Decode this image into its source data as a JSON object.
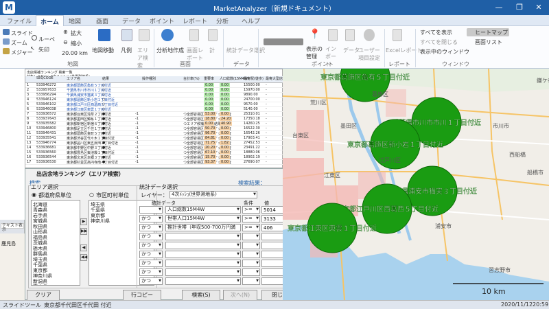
{
  "window": {
    "title": "MarketAnalyzer（新規ドキュメント）"
  },
  "menu": [
    "ファイル",
    "ホーム",
    "地図",
    "画面",
    "データ",
    "ポイント",
    "レポート",
    "分析",
    "ヘルプ"
  ],
  "ribbon": {
    "slide": "スライド",
    "zoom": "ズーム",
    "measure": "メジャー",
    "loupe": "ルーペ",
    "arrow": "矢印",
    "zoom_in": "拡大",
    "zoom_out": "縮小",
    "scale": "20.00 km",
    "map_move": "地図移動",
    "legend": "凡例",
    "area_search": "エリア検索",
    "map_create": "分析地作成",
    "screen_report": "画面レポート",
    "total": "計",
    "stats_select": "統計データ選択",
    "point_show": "表示の管理",
    "import": "インポート",
    "data": "データ",
    "user_settings": "ユーザー項目設定",
    "excel_report": "Excelレポート",
    "show_all": "すべてを表示",
    "hide_all": "すべてを閉じる",
    "window_show": "表示中のウィンドウ",
    "heatmap": "ヒートマップ",
    "screen_list": "画面リスト",
    "group_map": "地図",
    "group_screen": "画面",
    "group_data": "データ",
    "group_point": "ポイント",
    "group_report": "レポート",
    "group_window": "ウィンドウ"
  },
  "leftstrip": {
    "items": [
      "福岡県",
      "福岡市",
      "鹿児島",
      "テキスト表示",
      "福岡県"
    ]
  },
  "grid": {
    "title": "出店候補ランキング 検索一覧",
    "layer": "対象レイヤー：4次メッシュ(世界測地系)",
    "headers": [
      "SEQCODE",
      "エリア名",
      "結果",
      "操作種別",
      "台計率(%)",
      "重要率",
      "人口総数(15M4W)",
      "最寄駅(徒歩)",
      "最寄大型店"
    ],
    "rows": [
      [
        "533946272",
        "東京都葛飾区亀有５丁目付近",
        "○",
        "",
        "",
        "0.00",
        "0.00",
        "15500.00",
        "-"
      ],
      [
        "533957633",
        "千葉県市川市市川１丁目付近",
        "○",
        "",
        "",
        "0.00",
        "0.00",
        "15970.00",
        "-"
      ],
      [
        "533956294",
        "千葉県浦安市猫実３丁目付近",
        "○",
        "",
        "",
        "0.00",
        "0.00",
        "9890.00",
        "-"
      ],
      [
        "533946124",
        "東京都葛飾区新小岩１丁目付近",
        "○",
        "",
        "",
        "0.00",
        "0.00",
        "24700.00",
        "-"
      ],
      [
        "533946102",
        "東京都江戸川区西葛西５丁目付近",
        "○",
        "",
        "",
        "0.00",
        "0.00",
        "9570.00",
        "-"
      ],
      [
        "533946038",
        "東京都江東区東雲１丁目付近",
        "○",
        "",
        "",
        "0.00",
        "0.00",
        "5140.00",
        "-"
      ],
      [
        "533936572",
        "東京都台東区浅草２丁目付近",
        "●",
        "-1",
        "つ全部容易区のマーケット調査",
        "53.00",
        "0.00",
        "25310.01",
        "-"
      ],
      [
        "533937643",
        "東京都墨田区錦糸１丁目付近",
        "●",
        "-1",
        "つ全部容易区のマーケット調査",
        "18.80",
        "24.20",
        "17350.18",
        "-"
      ],
      [
        "533935582",
        "東京都新宿区新宿６丁目付近",
        "●",
        "-1",
        "つエリア候補の調査結果",
        "0.00",
        "40.90",
        "14260.25",
        "-"
      ],
      [
        "533946800",
        "東京都足立区千住１丁目付近",
        "●",
        "-1",
        "つ全部容易区のマーケット調査",
        "50.70",
        "0.00",
        "16522.30",
        "-"
      ],
      [
        "533946431",
        "東京都葛飾区金町５丁目付近",
        "●",
        "-1",
        "つ全部容易区のマーケット調査",
        "96.70",
        "0.00",
        "16542.26",
        "-"
      ],
      [
        "533935541",
        "東京都渋谷区代々木１丁目付近",
        "●",
        "-1",
        "つ全部容易区のマーケット調査",
        "84.81",
        "0.00",
        "17903.41",
        "-"
      ],
      [
        "533946774",
        "東京都品川区東五反田２丁目付近",
        "●",
        "-1",
        "つ全部容易区のマーケット調査",
        "71.75",
        "1.82",
        "27452.53",
        "-"
      ],
      [
        "533936681",
        "東京都中野区中野３丁目付近",
        "●",
        "-1",
        "つ全部容易区のマーケット調査",
        "20.20",
        "0.00",
        "23491.22",
        "-"
      ],
      [
        "533936560",
        "東京都豊島区東池袋１丁目付近",
        "●",
        "-1",
        "つ全部容易区のマーケット調査",
        "67.10",
        "0.00",
        "18880.06",
        "-"
      ],
      [
        "533936544",
        "東京都文京区本郷３丁目付近",
        "●",
        "-1",
        "つ全部容易区のマーケット調査",
        "15.70",
        "0.00",
        "18902.19",
        "-"
      ],
      [
        "533936530",
        "東京都杉並区高円寺南４丁目付近",
        "●",
        "-1",
        "つ全部容易区のマーケット調査",
        "93.37",
        "0.00",
        "27690.07",
        "-"
      ]
    ]
  },
  "dialog": {
    "title": "出店余地ランキング（エリア検索）",
    "search_label": "検索",
    "result_label": "検索結果：",
    "result_value": "0",
    "area_select": "エリア選択",
    "radio_pref": "都道府県単位",
    "radio_city": "市区町村単位",
    "prefectures": [
      "北海道",
      "青森県",
      "岩手県",
      "宮城県",
      "秋田県",
      "山形県",
      "福島県",
      "茨城県",
      "栃木県",
      "群馬県",
      "埼玉県",
      "千葉県",
      "東京都",
      "神奈川県",
      "新潟県",
      "富山県",
      "石川県",
      "福井県",
      "山梨県",
      "長野県"
    ],
    "selected": [
      "埼玉県",
      "千葉県",
      "東京都",
      "神奈川県"
    ],
    "stats_select": "統計データ選択",
    "layer_label": "レイヤー：",
    "layer_value": "4次ﾒｯｼｭ(世界測地系)",
    "stats_data": "統計データ",
    "cond_label": "条件",
    "value_label": "値",
    "conditions": [
      {
        "op": "",
        "field": "人口総数15M4W",
        "cmp": ">=",
        "value": "5014"
      },
      {
        "op": "かつ",
        "field": "世帯人口15M4W",
        "cmp": ">=",
        "value": "3133"
      },
      {
        "op": "かつ",
        "field": "推計世帯（年収500-700万円満_8階級）13",
        "cmp": ">=",
        "value": "406"
      },
      {
        "op": "かつ",
        "field": "",
        "cmp": "",
        "value": ""
      },
      {
        "op": "かつ",
        "field": "",
        "cmp": "",
        "value": ""
      },
      {
        "op": "かつ",
        "field": "",
        "cmp": "",
        "value": ""
      },
      {
        "op": "かつ",
        "field": "",
        "cmp": "",
        "value": ""
      },
      {
        "op": "かつ",
        "field": "",
        "cmp": "",
        "value": ""
      },
      {
        "op": "かつ",
        "field": "",
        "cmp": "",
        "value": ""
      }
    ],
    "clear": "クリア",
    "copy": "行コピー",
    "search_btn": "検索(S)",
    "next_btn": "次へ(N)",
    "close_btn": "閉じる"
  },
  "map": {
    "labels": [
      "荒川区",
      "葛飾区",
      "台東区",
      "墨田区",
      "江東区",
      "江戸川区",
      "市川市",
      "船橋市",
      "浦安市",
      "鎌ケ谷市",
      "習志野市",
      "西船橋"
    ],
    "circles": [
      {
        "label": "東京都葛飾区亀有５丁目付近"
      },
      {
        "label": "千葉県市川市市川１丁目付近"
      },
      {
        "label": "東京都葛飾区新小岩１丁目付近"
      },
      {
        "label": "千葉県浦安市猫実３丁目付近"
      },
      {
        "label": "東京都江戸川区西葛西５丁目付近"
      },
      {
        "label": "東京都江東区東雲１丁目付近"
      }
    ],
    "scale": "10 km",
    "circle_color": "#1a9c12"
  },
  "status": {
    "tool": "スライドツール",
    "location": "東京都千代田区千代田 付近",
    "date": "2020/11/12",
    "time": "20:59"
  }
}
